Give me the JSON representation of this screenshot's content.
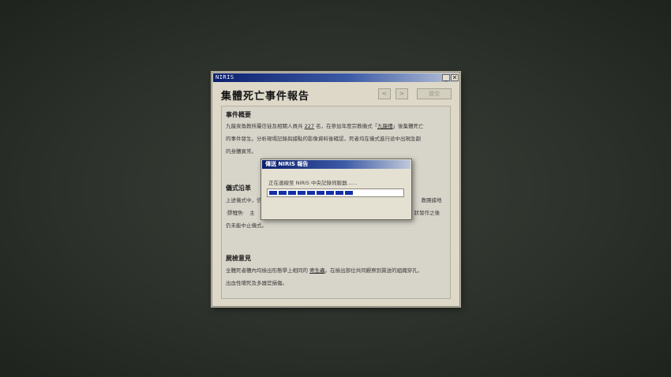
{
  "window": {
    "title": "NIRIS",
    "minimize_glyph": "_",
    "close_glyph": "✕"
  },
  "report": {
    "title": "集體死亡事件報告",
    "prev_glyph": "<",
    "next_glyph": ">",
    "submit_label": "提交"
  },
  "sections": {
    "overview": {
      "heading": "事件概要",
      "lines": [
        [
          "九龍泉角教所屬信徒及相關人員共 ",
          "227",
          " 名，在參加年度宗教儀式「",
          "九龍禮",
          "」後集體死亡"
        ],
        [
          "的事件發生。分析現場記錄與據點的影像資料後確認，死者均在儀式進行途中出現急劇"
        ],
        [
          "的身體異常。"
        ]
      ]
    },
    "ritual": {
      "heading": "儀式沿革",
      "lines": [
        [
          "上述儀式中，信",
          "",
          "",
          "",
          "教團據地"
        ],
        [
          "‧膠鯉魚‧　主",
          "",
          "",
          "",
          "狀發作之後"
        ],
        [
          "仍未能中止儀式。"
        ]
      ]
    },
    "autopsy": {
      "heading": "屍檢意見",
      "lines": [
        [
          "全體死者體內均檢出形態學上相同的 ",
          "寄生蟲",
          "。在檢出部位共同觀察到貫送的組織穿孔，"
        ],
        [
          "出血性壞死及多器官損傷。"
        ]
      ]
    }
  },
  "progress_dialog": {
    "title": "傳送 NIRIS 報告",
    "message": "正在連線至 NIRIS 中央記錄伺服器……",
    "progress": 0.63
  }
}
